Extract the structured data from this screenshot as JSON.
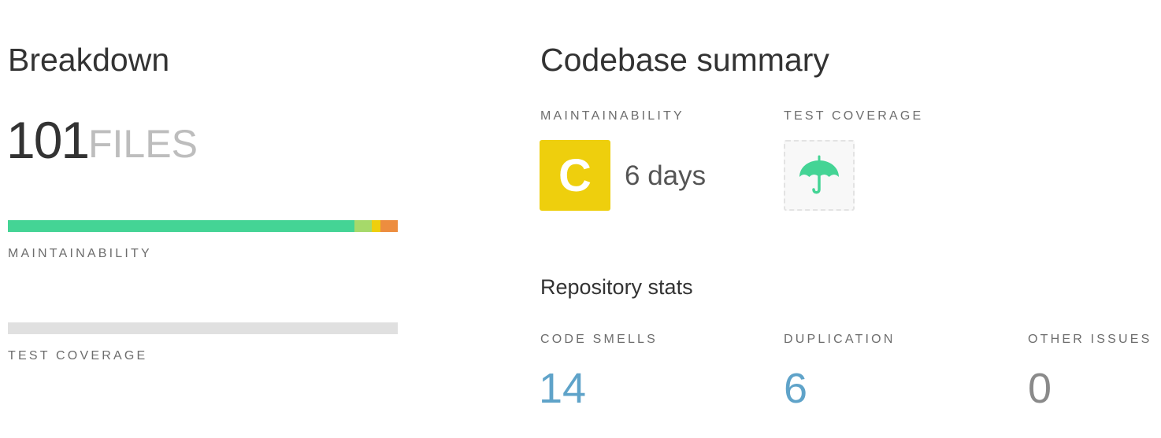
{
  "breakdown": {
    "title": "Breakdown",
    "files_count": "101",
    "files_label": "FILES",
    "maintainability_label": "MAINTAINABILITY",
    "maintainability_distribution": [
      {
        "grade": "A",
        "fraction": 0.889,
        "color": "#44d495"
      },
      {
        "grade": "B",
        "fraction": 0.044,
        "color": "#a6d96a"
      },
      {
        "grade": "C",
        "fraction": 0.022,
        "color": "#eecf0d"
      },
      {
        "grade": "D",
        "fraction": 0.045,
        "color": "#ed8d3f"
      }
    ],
    "test_coverage_label": "TEST COVERAGE"
  },
  "summary": {
    "title": "Codebase summary",
    "maintainability_label": "MAINTAINABILITY",
    "grade": "C",
    "grade_color": "#eecf0d",
    "debt_time": "6 days",
    "test_coverage_label": "TEST COVERAGE",
    "coverage_icon": "umbrella-icon",
    "coverage_icon_color": "#44d495"
  },
  "repo_stats": {
    "title": "Repository stats",
    "code_smells_label": "CODE SMELLS",
    "code_smells_value": "14",
    "duplication_label": "DUPLICATION",
    "duplication_value": "6",
    "other_issues_label": "OTHER ISSUES",
    "other_issues_value": "0",
    "link_color": "#5fa3c9",
    "zero_color": "#8a8a8a"
  }
}
